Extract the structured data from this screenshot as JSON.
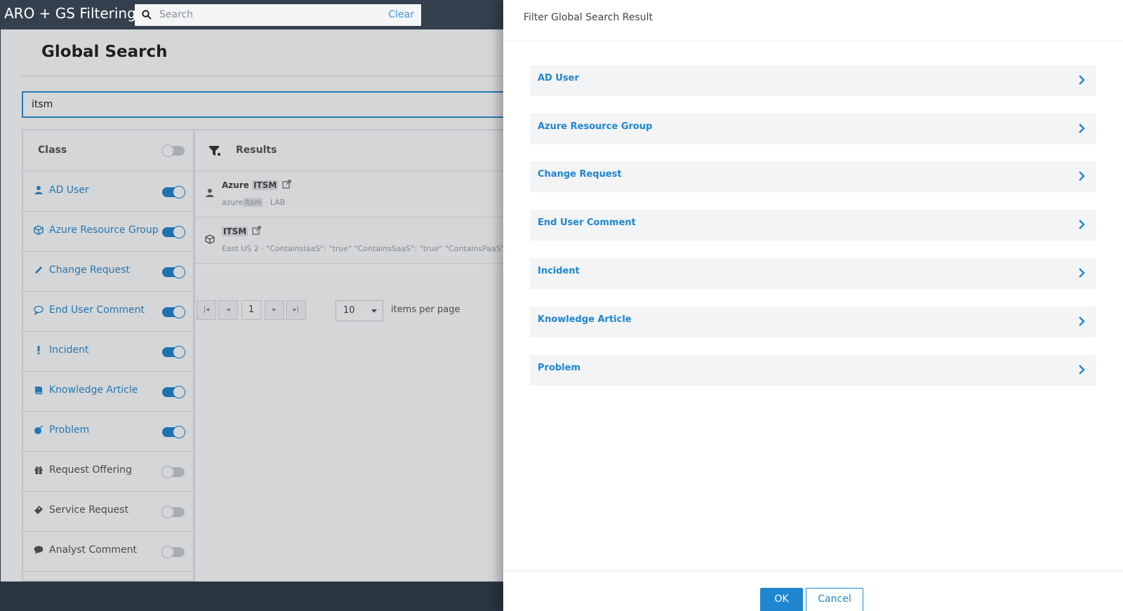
{
  "topbar": {
    "app_title": "ARO + GS Filtering",
    "search_placeholder": "Search",
    "clear_label": "Clear"
  },
  "main": {
    "page_title": "Global Search",
    "query": "itsm",
    "class_header": "Class",
    "classes": [
      {
        "label": "AD User",
        "icon": "user-icon",
        "enabled": true
      },
      {
        "label": "Azure Resource Group",
        "icon": "cube-icon",
        "enabled": true
      },
      {
        "label": "Change Request",
        "icon": "pencil-icon",
        "enabled": true
      },
      {
        "label": "End User Comment",
        "icon": "comment-outline-icon",
        "enabled": true
      },
      {
        "label": "Incident",
        "icon": "exclamation-icon",
        "enabled": true
      },
      {
        "label": "Knowledge Article",
        "icon": "book-icon",
        "enabled": true
      },
      {
        "label": "Problem",
        "icon": "bomb-icon",
        "enabled": true
      },
      {
        "label": "Request Offering",
        "icon": "gift-icon",
        "enabled": false
      },
      {
        "label": "Service Request",
        "icon": "ticket-icon",
        "enabled": false
      },
      {
        "label": "Analyst Comment",
        "icon": "comment-icon",
        "enabled": false
      }
    ],
    "results_header": "Results",
    "results": [
      {
        "title_prefix": "Azure ",
        "title_highlight": "ITSM",
        "subtitle_prefix": "azure",
        "subtitle_highlight": "itsm",
        "subtitle_sep": " · ",
        "subtitle_rest": "LAB",
        "icon": "user-icon"
      },
      {
        "title_prefix": "",
        "title_highlight": "ITSM",
        "subtitle_prefix": "East US 2",
        "subtitle_highlight": "",
        "subtitle_sep": " · ",
        "subtitle_rest": "\"ContainsIaaS\": \"true\" \"ContainsSaaS\": \"true\" \"ContainsPaaS\": \"t",
        "icon": "cube-icon"
      }
    ],
    "pager": {
      "current_page": "1",
      "page_size": "10",
      "items_per_page_label": "items per page"
    }
  },
  "dialog": {
    "title": "Filter Global Search Result",
    "filters": [
      "AD User",
      "Azure Resource Group",
      "Change Request",
      "End User Comment",
      "Incident",
      "Knowledge Article",
      "Problem"
    ],
    "ok_label": "OK",
    "cancel_label": "Cancel"
  },
  "colors": {
    "accent": "#1f86cf",
    "topbar": "#34404d"
  }
}
